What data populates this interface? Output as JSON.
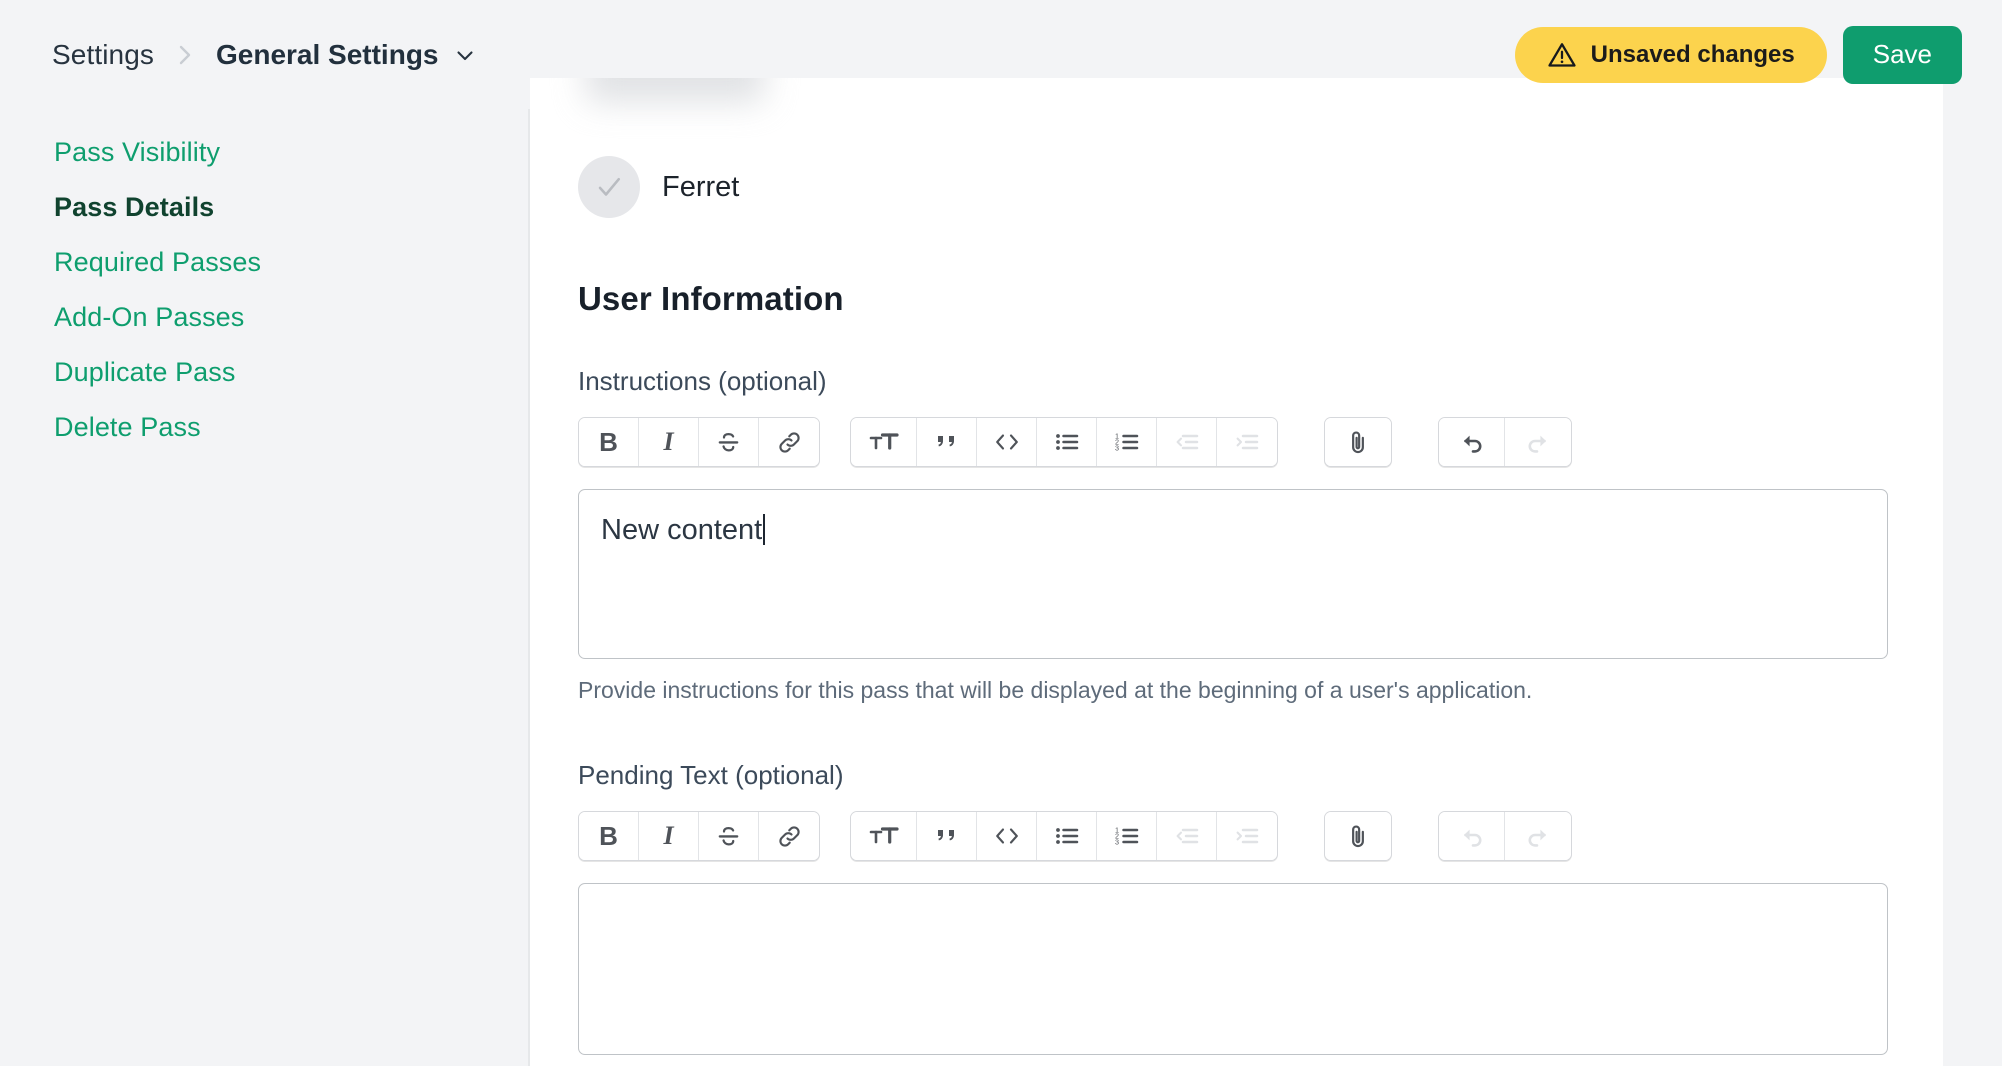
{
  "header": {
    "breadcrumb": {
      "root": "Settings",
      "separator": "›",
      "current": "General Settings",
      "caret_icon": "chevron-down-icon"
    },
    "unsaved_badge": {
      "label": "Unsaved changes",
      "icon": "warning-triangle-icon",
      "color": "#fcd34d"
    },
    "save_button": {
      "label": "Save",
      "color": "#0f9d6e"
    }
  },
  "sidebar": {
    "items": [
      {
        "label": "Pass Visibility",
        "active": false
      },
      {
        "label": "Pass Details",
        "active": true
      },
      {
        "label": "Required Passes",
        "active": false
      },
      {
        "label": "Add-On Passes",
        "active": false
      },
      {
        "label": "Duplicate Pass",
        "active": false
      },
      {
        "label": "Delete Pass",
        "active": false
      }
    ],
    "link_color": "#0e9e6e",
    "active_color": "#10432f"
  },
  "main": {
    "entity": {
      "name": "Ferret",
      "avatar_icon": "check-circle-icon"
    },
    "section_title": "User Information",
    "fields": [
      {
        "label": "Instructions (optional)",
        "value": "New content",
        "placeholder": "",
        "help": "Provide instructions for this pass that will be displayed at the beginning of a user's application.",
        "has_caret": true,
        "toolbar": {
          "group1": [
            {
              "icon": "bold-icon",
              "label": "B",
              "state": "enabled"
            },
            {
              "icon": "italic-icon",
              "label": "I",
              "state": "enabled"
            },
            {
              "icon": "strikethrough-icon",
              "label": "S",
              "state": "enabled"
            },
            {
              "icon": "link-icon",
              "label": "",
              "state": "enabled"
            }
          ],
          "group2": [
            {
              "icon": "heading-text-size-icon",
              "label": "",
              "state": "enabled"
            },
            {
              "icon": "blockquote-icon",
              "label": "",
              "state": "enabled"
            },
            {
              "icon": "code-icon",
              "label": "",
              "state": "enabled"
            },
            {
              "icon": "bullet-list-icon",
              "label": "",
              "state": "enabled"
            },
            {
              "icon": "numbered-list-icon",
              "label": "",
              "state": "enabled"
            },
            {
              "icon": "outdent-icon",
              "label": "",
              "state": "disabled"
            },
            {
              "icon": "indent-icon",
              "label": "",
              "state": "disabled"
            }
          ],
          "group3": [
            {
              "icon": "attachment-paperclip-icon",
              "label": "",
              "state": "enabled"
            }
          ],
          "group4": [
            {
              "icon": "undo-icon",
              "label": "",
              "state": "enabled"
            },
            {
              "icon": "redo-icon",
              "label": "",
              "state": "disabled"
            }
          ]
        }
      },
      {
        "label": "Pending Text (optional)",
        "value": "",
        "placeholder": "",
        "help": "",
        "has_caret": false,
        "toolbar": {
          "group1": [
            {
              "icon": "bold-icon",
              "label": "B",
              "state": "enabled"
            },
            {
              "icon": "italic-icon",
              "label": "I",
              "state": "enabled"
            },
            {
              "icon": "strikethrough-icon",
              "label": "S",
              "state": "enabled"
            },
            {
              "icon": "link-icon",
              "label": "",
              "state": "enabled"
            }
          ],
          "group2": [
            {
              "icon": "heading-text-size-icon",
              "label": "",
              "state": "enabled"
            },
            {
              "icon": "blockquote-icon",
              "label": "",
              "state": "enabled"
            },
            {
              "icon": "code-icon",
              "label": "",
              "state": "enabled"
            },
            {
              "icon": "bullet-list-icon",
              "label": "",
              "state": "enabled"
            },
            {
              "icon": "numbered-list-icon",
              "label": "",
              "state": "enabled"
            },
            {
              "icon": "outdent-icon",
              "label": "",
              "state": "disabled"
            },
            {
              "icon": "indent-icon",
              "label": "",
              "state": "disabled"
            }
          ],
          "group3": [
            {
              "icon": "attachment-paperclip-icon",
              "label": "",
              "state": "enabled"
            }
          ],
          "group4": [
            {
              "icon": "undo-icon",
              "label": "",
              "state": "disabled"
            },
            {
              "icon": "redo-icon",
              "label": "",
              "state": "disabled"
            }
          ]
        }
      }
    ]
  }
}
